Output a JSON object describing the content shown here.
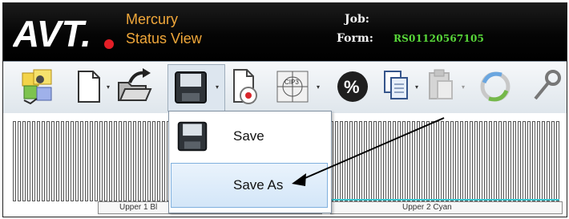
{
  "header": {
    "logo_text": "AVT.",
    "app_name": "Mercury",
    "app_view": "Status View",
    "job_label": "Job:",
    "form_label": "Form:",
    "form_value": "RS01120567105"
  },
  "toolbar": {
    "tools": [
      "job-settings-icon",
      "new-page-icon",
      "open-folder-icon",
      "save-icon",
      "new-document-target-icon",
      "cip3-icon",
      "percent-icon",
      "copy-icon",
      "paste-icon",
      "refresh-icon",
      "tools-icon"
    ],
    "cip3_label": "CIP3",
    "percent_label": "%"
  },
  "menu": {
    "save_label": "Save",
    "save_as_label": "Save As"
  },
  "strip": {
    "zone_1": "Upper 1 Bl",
    "zone_2": "Upper 2 Cyan",
    "accent_color": "#37c6cf"
  }
}
